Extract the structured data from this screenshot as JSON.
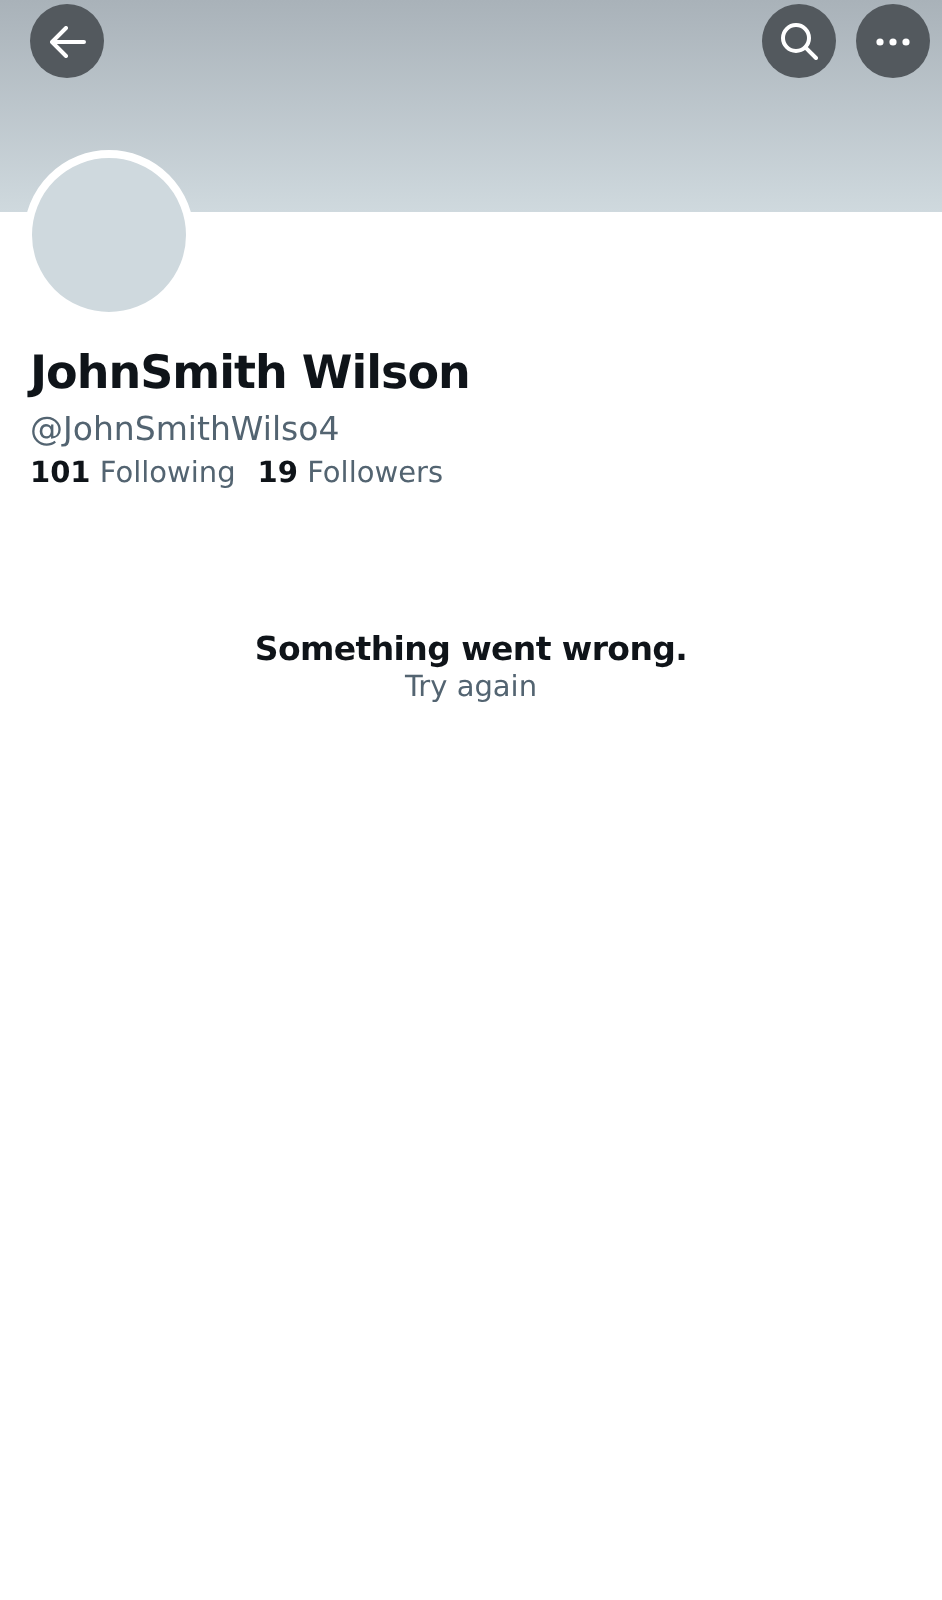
{
  "header": {
    "buttons": [
      {
        "kind": "back"
      },
      {
        "kind": "search"
      },
      {
        "kind": "more"
      }
    ]
  },
  "profile": {
    "name": "JohnSmith Wilson",
    "handle": "@JohnSmithWilso4",
    "stats": [
      "**101** Following",
      "**19** Followers"
    ]
  },
  "error": {
    "message": "Something went wrong.",
    "action": "Try again"
  }
}
